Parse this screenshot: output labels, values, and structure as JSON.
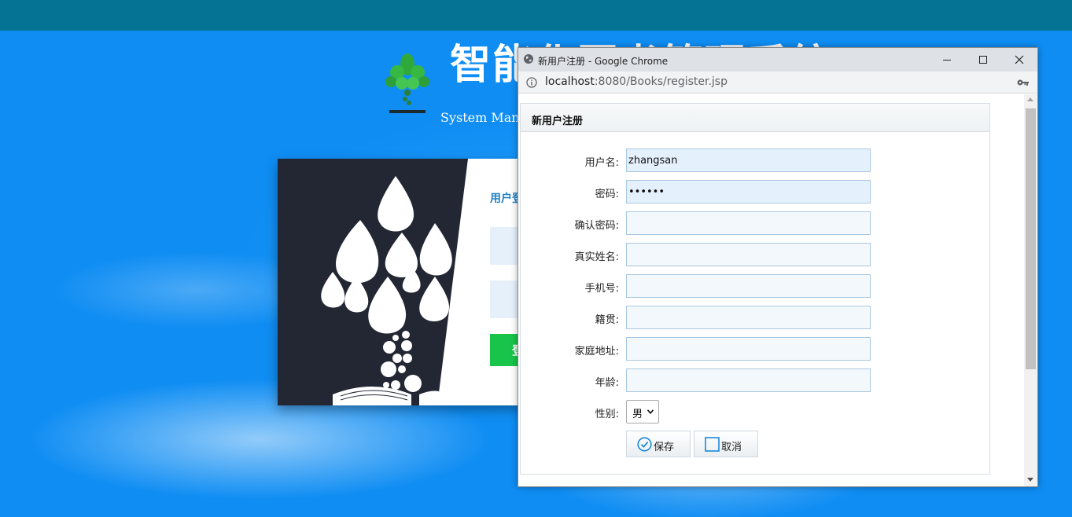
{
  "background_page": {
    "system_title": "智能化图书管理系统",
    "system_subtitle": "System Management",
    "login": {
      "title": "用户登录",
      "button_label": "登录"
    }
  },
  "popup": {
    "window_title": "新用户注册 - Google Chrome",
    "url_host": "localhost",
    "url_rest": ":8080/Books/register.jsp",
    "panel_title": "新用户注册",
    "fields": {
      "username": {
        "label": "用户名:",
        "value": "zhangsan"
      },
      "password": {
        "label": "密码:",
        "value": "••••••"
      },
      "confirm_password": {
        "label": "确认密码:",
        "value": ""
      },
      "real_name": {
        "label": "真实姓名:",
        "value": ""
      },
      "phone": {
        "label": "手机号:",
        "value": ""
      },
      "native_place": {
        "label": "籍贯:",
        "value": ""
      },
      "address": {
        "label": "家庭地址:",
        "value": ""
      },
      "age": {
        "label": "年龄:",
        "value": ""
      },
      "gender": {
        "label": "性别:",
        "value": "男"
      }
    },
    "buttons": {
      "save": "保存",
      "cancel": "取消"
    }
  },
  "icons": [
    "globe-icon",
    "minimize-icon",
    "maximize-icon",
    "close-icon",
    "info-icon",
    "key-icon",
    "check-circle-icon",
    "square-icon",
    "chevron-down-icon",
    "tree-logo-icon"
  ],
  "colors": {
    "topbar": "#057393",
    "sky": "#1a8ff0",
    "login_button": "#18c44a",
    "input_fill": "#e5f0fd",
    "accent": "#1a88d8"
  }
}
